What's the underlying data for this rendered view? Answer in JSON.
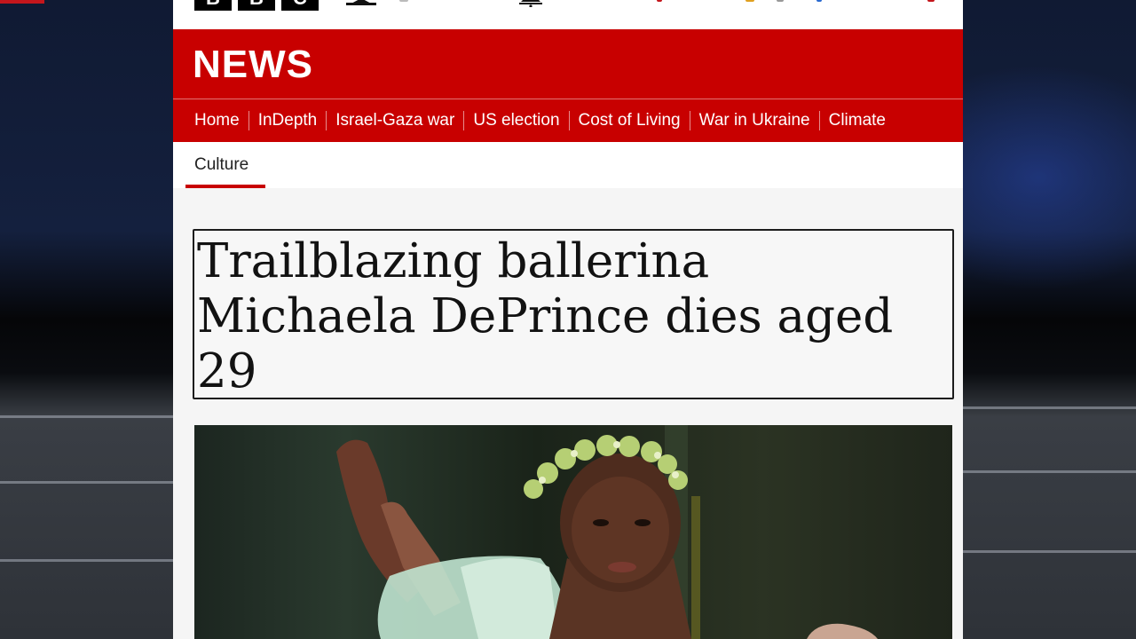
{
  "top_bar": {
    "logo_letters": [
      "B",
      "B",
      "C"
    ]
  },
  "header": {
    "title": "NEWS"
  },
  "nav": {
    "items": [
      "Home",
      "InDepth",
      "Israel-Gaza war",
      "US election",
      "Cost of Living",
      "War in Ukraine",
      "Climate"
    ]
  },
  "sub_nav": {
    "active": "Culture"
  },
  "article": {
    "headline": "Trailblazing ballerina Michaela DePrince dies aged 29"
  },
  "colors": {
    "brand_red": "#c80000",
    "accent_red": "#c4161c"
  },
  "icons": [
    "user-icon",
    "notification-bell-icon"
  ]
}
